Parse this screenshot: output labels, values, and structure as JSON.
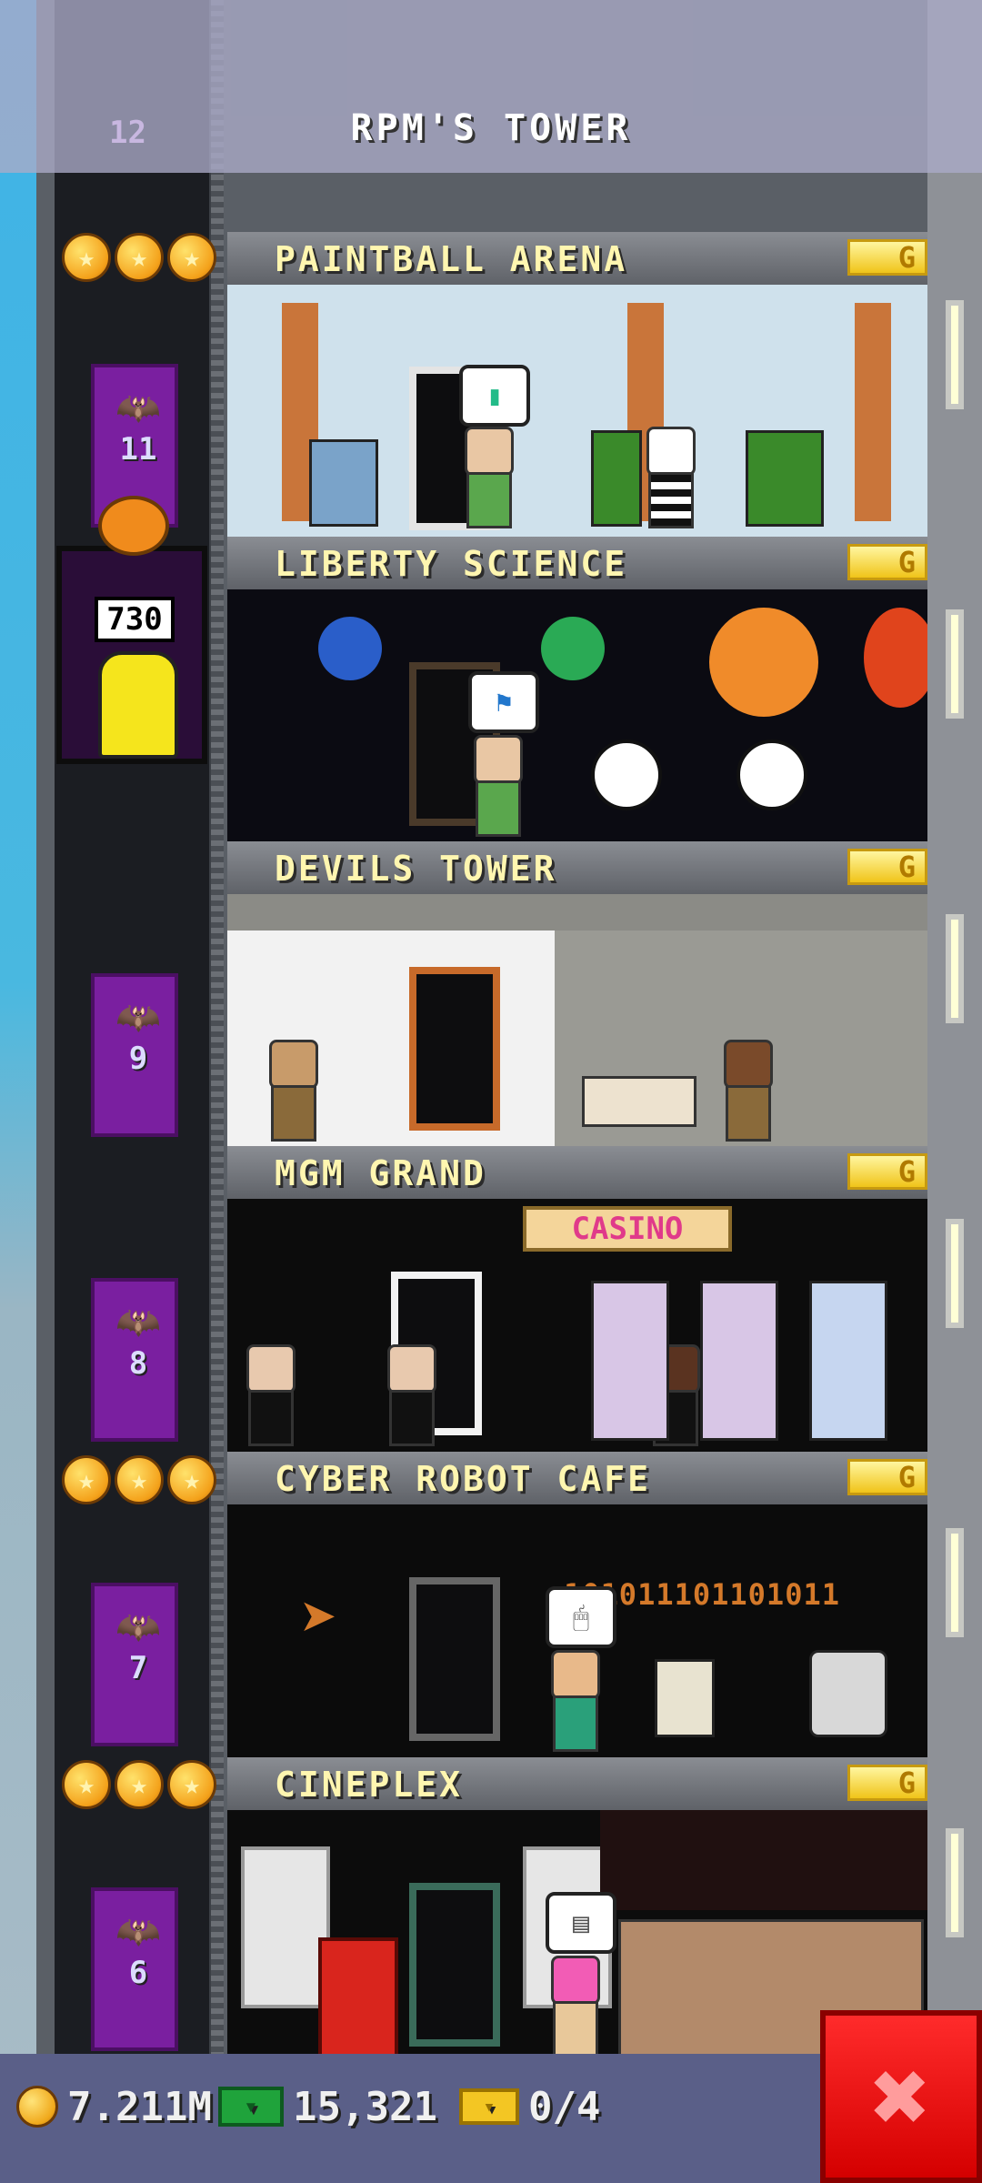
{
  "header": {
    "title": "RPM'S TOWER",
    "top_floor_number": "12"
  },
  "elevator": {
    "badge_value": "730",
    "floor_numbers": [
      "11",
      "9",
      "8",
      "7",
      "6"
    ]
  },
  "floors": [
    {
      "name": "PAINTBALL ARENA",
      "badge": "G",
      "stars": 3,
      "bubble_icon": "paint-icon"
    },
    {
      "name": "LIBERTY SCIENCE",
      "badge": "G",
      "stars": 0,
      "bubble_icon": "flag-icon"
    },
    {
      "name": "DEVILS TOWER",
      "badge": "G",
      "stars": 0
    },
    {
      "name": "MGM GRAND",
      "badge": "G",
      "stars": 0,
      "sign": "CASINO"
    },
    {
      "name": "CYBER ROBOT CAFE",
      "badge": "G",
      "stars": 3,
      "wall_text": "101011101101011"
    },
    {
      "name": "CINEPLEX",
      "badge": "G",
      "stars": 3
    }
  ],
  "bottom_bar": {
    "coins": "7.211M",
    "bux": "15,321",
    "tickets": "0/4",
    "close_label": "✖"
  }
}
